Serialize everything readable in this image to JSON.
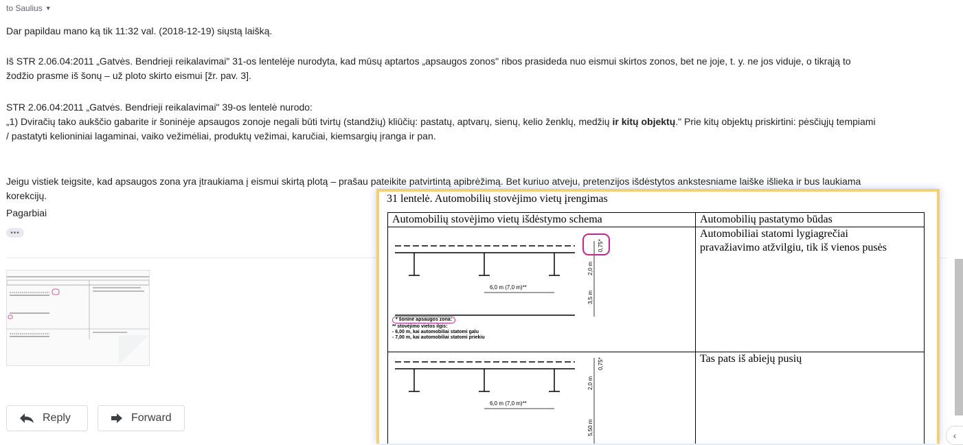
{
  "header": {
    "recipient": "to Saulius"
  },
  "body": {
    "p1": "Dar papildau mano ką tik 11:32 val. (2018-12-19) siųstą laišką.",
    "p2_line1": "Iš STR 2.06.04:2011 „Gatvės. Bendrieji reikalavimai\"  31-os lentelėje nurodyta, kad mūsų aptartos „apsaugos zonos\" ribos prasideda nuo eismui skirtos zonos, bet ne joje, t. y. ne jos viduje, o tikrąją to",
    "p2_line2": "žodžio prasme iš šonų – už ploto skirto eismui [žr. pav. 3].",
    "p3_line1": "STR 2.06.04:2011 „Gatvės. Bendrieji reikalavimai\" 39-os lentelė nurodo:",
    "p3_line2_a": " „1) Dviračių tako aukščio gabarite ir šoninėje apsaugos zonoje negali būti tvirtų (standžių) kliūčių: pastatų, aptvarų, sienų, kelio ženklų, medžių ",
    "p3_line2_bold": "ir kitų objektų",
    "p3_line2_b": ".\" Prie kitų objektų priskirtini: pėsčiųjų tempiami",
    "p3_line3": "/ pastatyti kelioniniai lagaminai, vaiko vežimėliai, produktų vežimai, karučiai, kiemsargių įranga ir pan.",
    "p4_line1": "Jeigu vistiek teigsite, kad apsaugos zona yra įtraukiama į eismui skirtą plotą – prašau pateikite patvirtintą apibrėžimą. Bet kuriuo atveju, pretenzijos išdėstytos ankstesniame laiške išlieka ir bus laukiama",
    "p4_line2": "korekcijų.",
    "signature": "Pagarbiai",
    "ellipsis": "•••"
  },
  "actions": {
    "reply_label": "Reply",
    "forward_label": "Forward"
  },
  "attachment_image": {
    "caption": "31 lentelė. Automobilių stovėjimo vietų įrengimas",
    "col1_header": "Automobilių stovėjimo vietų išdėstymo schema",
    "col2_header": "Automobilių pastatymo būdas",
    "row1_method_line1": "Automobiliai statomi lygiagrečiai",
    "row1_method_line2": "pravažiavimo atžvilgiu, tik iš vienos pusės",
    "row2_method": "Tas pats iš abiejų pusių",
    "dim_075": "0,75*",
    "dim_20": "2,0 m",
    "dim_35": "3,5 m",
    "dim_550": "5,50 m",
    "dim_length": "6,0 m (7,0 m)**",
    "legend_1": "* šoninė apsaugos zona:",
    "legend_2": "** stovėjimo vietos ilgis:",
    "legend_3": "- 6,00 m, kai automobiliai statomi galu",
    "legend_4": "- 7,00 m, kai automobiliai statomi priekiu"
  },
  "colors": {
    "highlight_border": "#f8cf6e",
    "annotation_magenta": "#d0218c",
    "scrollbar": "#c1c1c1"
  },
  "icons": {
    "reply": "reply-arrow-icon",
    "forward": "forward-arrow-icon",
    "caret": "caret-down-icon",
    "side": "chevron-left-icon"
  }
}
